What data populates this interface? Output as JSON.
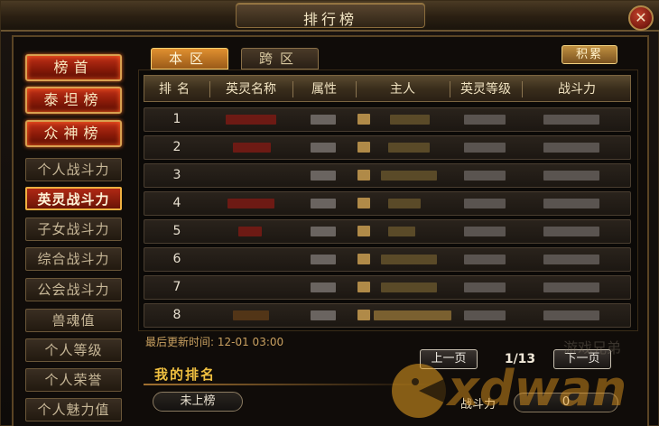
{
  "window": {
    "title": "排行榜",
    "close_glyph": "✕"
  },
  "tabs": [
    {
      "label": "本区",
      "active": true
    },
    {
      "label": "跨区",
      "active": false
    }
  ],
  "score_button": "积累",
  "menu_top": [
    {
      "label": "榜首"
    },
    {
      "label": "泰坦榜"
    },
    {
      "label": "众神榜"
    }
  ],
  "menu": [
    {
      "label": "个人战斗力",
      "active": false
    },
    {
      "label": "英灵战斗力",
      "active": true
    },
    {
      "label": "子女战斗力",
      "active": false
    },
    {
      "label": "综合战斗力",
      "active": false
    },
    {
      "label": "公会战斗力",
      "active": false
    },
    {
      "label": "兽魂值",
      "active": false
    },
    {
      "label": "个人等级",
      "active": false
    },
    {
      "label": "个人荣誉",
      "active": false
    },
    {
      "label": "个人魅力值",
      "active": false
    }
  ],
  "table": {
    "headers": [
      "排名",
      "英灵名称",
      "属性",
      "主人",
      "英灵等级",
      "战斗力"
    ],
    "rows": [
      {
        "rank": "1"
      },
      {
        "rank": "2"
      },
      {
        "rank": "3"
      },
      {
        "rank": "4"
      },
      {
        "rank": "5"
      },
      {
        "rank": "6"
      },
      {
        "rank": "7"
      },
      {
        "rank": "8"
      }
    ]
  },
  "last_update": {
    "label": "最后更新时间:",
    "value": "12-01 03:00"
  },
  "pagination": {
    "prev": "上一页",
    "next": "下一页",
    "current": "1/13"
  },
  "my_rank": {
    "title": "我的排名",
    "status": "未上榜",
    "power_label": "战斗力",
    "power_value": "0"
  },
  "watermark": {
    "text": "xdwan",
    "sub": "游戏兄弟"
  },
  "colors": {
    "accent_red": "#b02814",
    "gold": "#f0c040",
    "frame": "#5a4424"
  }
}
